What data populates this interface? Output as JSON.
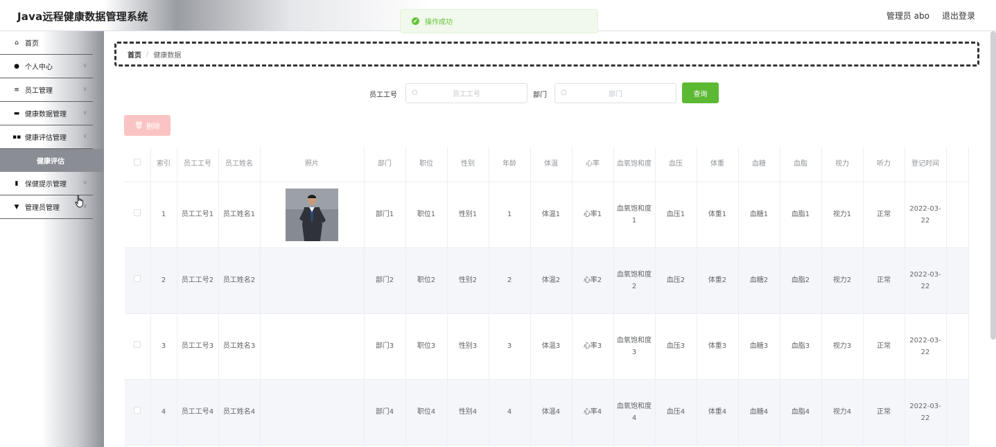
{
  "header": {
    "app_title": "Java远程健康数据管理系统",
    "user_label": "管理员 abo",
    "logout_label": "退出登录"
  },
  "toast": {
    "text": "操作成功",
    "color": "#67c23a"
  },
  "sidebar": {
    "items": [
      {
        "label": "首页",
        "icon": "home-icon"
      },
      {
        "label": "个人中心",
        "icon": "user-icon"
      },
      {
        "label": "员工管理",
        "icon": "list-icon"
      },
      {
        "label": "健康数据管理",
        "icon": "briefcase-icon"
      },
      {
        "label": "健康评估管理",
        "icon": "grid-icon"
      },
      {
        "label": "健康评估",
        "icon": ""
      },
      {
        "label": "保健提示管理",
        "icon": "clipboard-icon"
      },
      {
        "label": "管理员管理",
        "icon": "badge-icon"
      }
    ]
  },
  "breadcrumb": {
    "home": "首页",
    "separator": "/",
    "current": "健康数据"
  },
  "search": {
    "employee_no_label": "员工工号",
    "employee_no_placeholder": "员工工号",
    "dept_label": "部门",
    "dept_placeholder": "部门",
    "button": "查询"
  },
  "toolbar": {
    "delete_label": "删除"
  },
  "table": {
    "headers": [
      "",
      "索引",
      "员工工号",
      "员工姓名",
      "照片",
      "部门",
      "职位",
      "性别",
      "年龄",
      "体温",
      "心率",
      "血氧饱和度",
      "血压",
      "体重",
      "血糖",
      "血脂",
      "视力",
      "听力",
      "登记时间",
      ""
    ],
    "rows": [
      {
        "index": "1",
        "emp_no": "员工工号1",
        "emp_name": "员工姓名1",
        "dept": "部门1",
        "position": "职位1",
        "gender": "性别1",
        "age": "1",
        "temp": "体温1",
        "heart": "心率1",
        "oxygen": "血氧饱和度1",
        "bp": "血压1",
        "weight": "体重1",
        "sugar": "血糖1",
        "lipid": "血脂1",
        "vision": "视力1",
        "hearing": "正常",
        "date": "2022-03-22",
        "has_photo": true
      },
      {
        "index": "2",
        "emp_no": "员工工号2",
        "emp_name": "员工姓名2",
        "dept": "部门2",
        "position": "职位2",
        "gender": "性别2",
        "age": "2",
        "temp": "体温2",
        "heart": "心率2",
        "oxygen": "血氧饱和度2",
        "bp": "血压2",
        "weight": "体重2",
        "sugar": "血糖2",
        "lipid": "血脂2",
        "vision": "视力2",
        "hearing": "正常",
        "date": "2022-03-22",
        "has_photo": false
      },
      {
        "index": "3",
        "emp_no": "员工工号3",
        "emp_name": "员工姓名3",
        "dept": "部门3",
        "position": "职位3",
        "gender": "性别3",
        "age": "3",
        "temp": "体温3",
        "heart": "心率3",
        "oxygen": "血氧饱和度3",
        "bp": "血压3",
        "weight": "体重3",
        "sugar": "血糖3",
        "lipid": "血脂3",
        "vision": "视力3",
        "hearing": "正常",
        "date": "2022-03-22",
        "has_photo": false
      },
      {
        "index": "4",
        "emp_no": "员工工号4",
        "emp_name": "员工姓名4",
        "dept": "部门4",
        "position": "职位4",
        "gender": "性别4",
        "age": "4",
        "temp": "体温4",
        "heart": "心率4",
        "oxygen": "血氧饱和度4",
        "bp": "血压4",
        "weight": "体重4",
        "sugar": "血糖4",
        "lipid": "血脂4",
        "vision": "视力4",
        "hearing": "正常",
        "date": "2022-03-22",
        "has_photo": false
      }
    ]
  },
  "colors": {
    "primary_green": "#5cb934",
    "delete_pink": "#fbc4c4",
    "row_alt": "#f5f6fa"
  }
}
